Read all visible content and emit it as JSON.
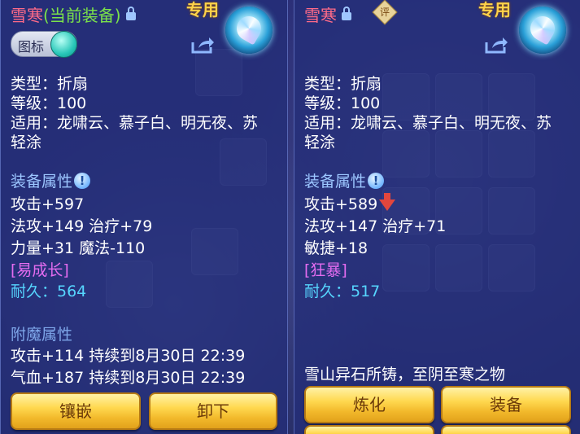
{
  "left": {
    "item_name": "雪寒",
    "equipped_tag": "(当前装备)",
    "exclusive_label": "专用",
    "toggle_label": "图标",
    "type_line": "类型：折扇",
    "level_line": "等级：100",
    "suitable_line1": "适用：龙啸云、慕子白、明无夜、苏",
    "suitable_line2": "轻涂",
    "equip_attr_title": "装备属性",
    "stat_attack": "攻击+597",
    "stat_line2": "法攻+149 治疗+79",
    "stat_line3": "力量+31 魔法-110",
    "special": "[易成长]",
    "durability": "耐久：564",
    "enchant_title": "附魔属性",
    "enchant_1": "攻击+114 持续到8月30日 22:39",
    "enchant_2": "气血+187 持续到8月30日 22:39",
    "buttons": {
      "inlay": "镶嵌",
      "unequip": "卸下"
    }
  },
  "right": {
    "item_name": "雪寒",
    "rate_badge": "评",
    "exclusive_label": "专用",
    "type_line": "类型：折扇",
    "level_line": "等级：100",
    "suitable_line1": "适用：龙啸云、慕子白、明无夜、苏",
    "suitable_line2": "轻涂",
    "equip_attr_title": "装备属性",
    "stat_attack": "攻击+589",
    "stat_line2": "法攻+147 治疗+71",
    "stat_line3": "敏捷+18",
    "special": "[狂暴]",
    "durability": "耐久：517",
    "description": "雪山异石所铸，至阴至寒之物",
    "buttons": {
      "refine": "炼化",
      "equip": "装备"
    }
  },
  "colors": {
    "panel": "#2e3a8c",
    "item_name": "#ff6b88",
    "equipped_tag": "#7be34a",
    "section": "#9cc6ff",
    "special": "#e46cf0",
    "durability": "#56d6ff",
    "button": "#f2c53a"
  }
}
